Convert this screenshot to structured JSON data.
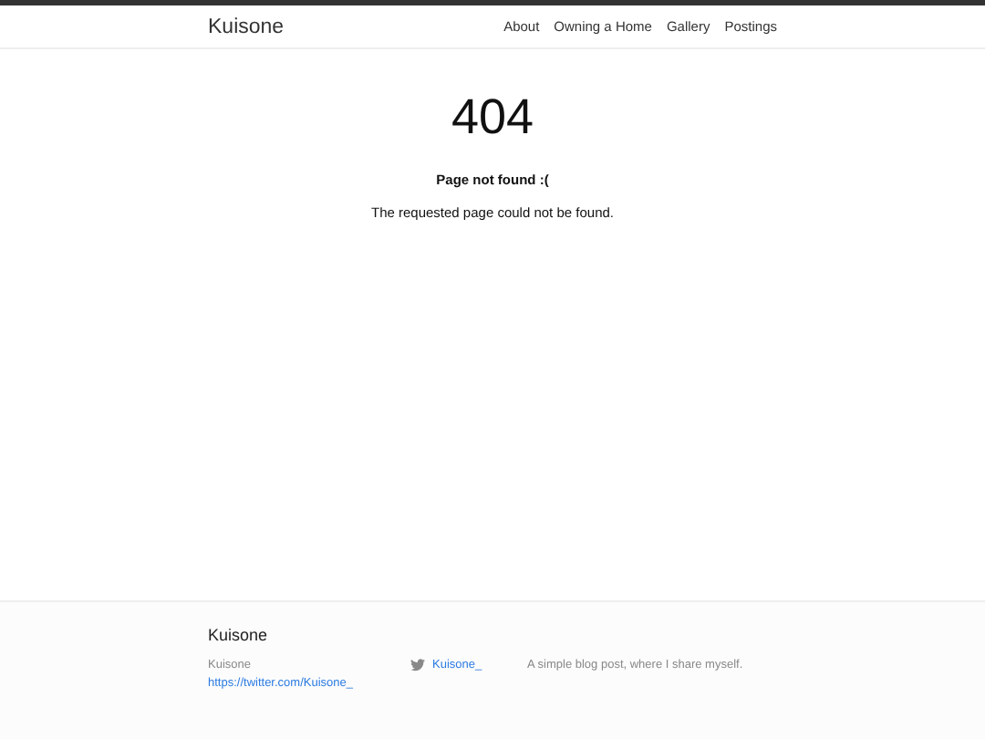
{
  "header": {
    "site_title": "Kuisone",
    "nav": [
      "About",
      "Owning a Home",
      "Gallery",
      "Postings"
    ]
  },
  "main": {
    "code": "404",
    "heading": "Page not found :(",
    "message": "The requested page could not be found."
  },
  "footer": {
    "title": "Kuisone",
    "name": "Kuisone",
    "url": "https://twitter.com/Kuisone_",
    "twitter_handle": "Kuisone_",
    "description": "A simple blog post, where I share myself."
  }
}
